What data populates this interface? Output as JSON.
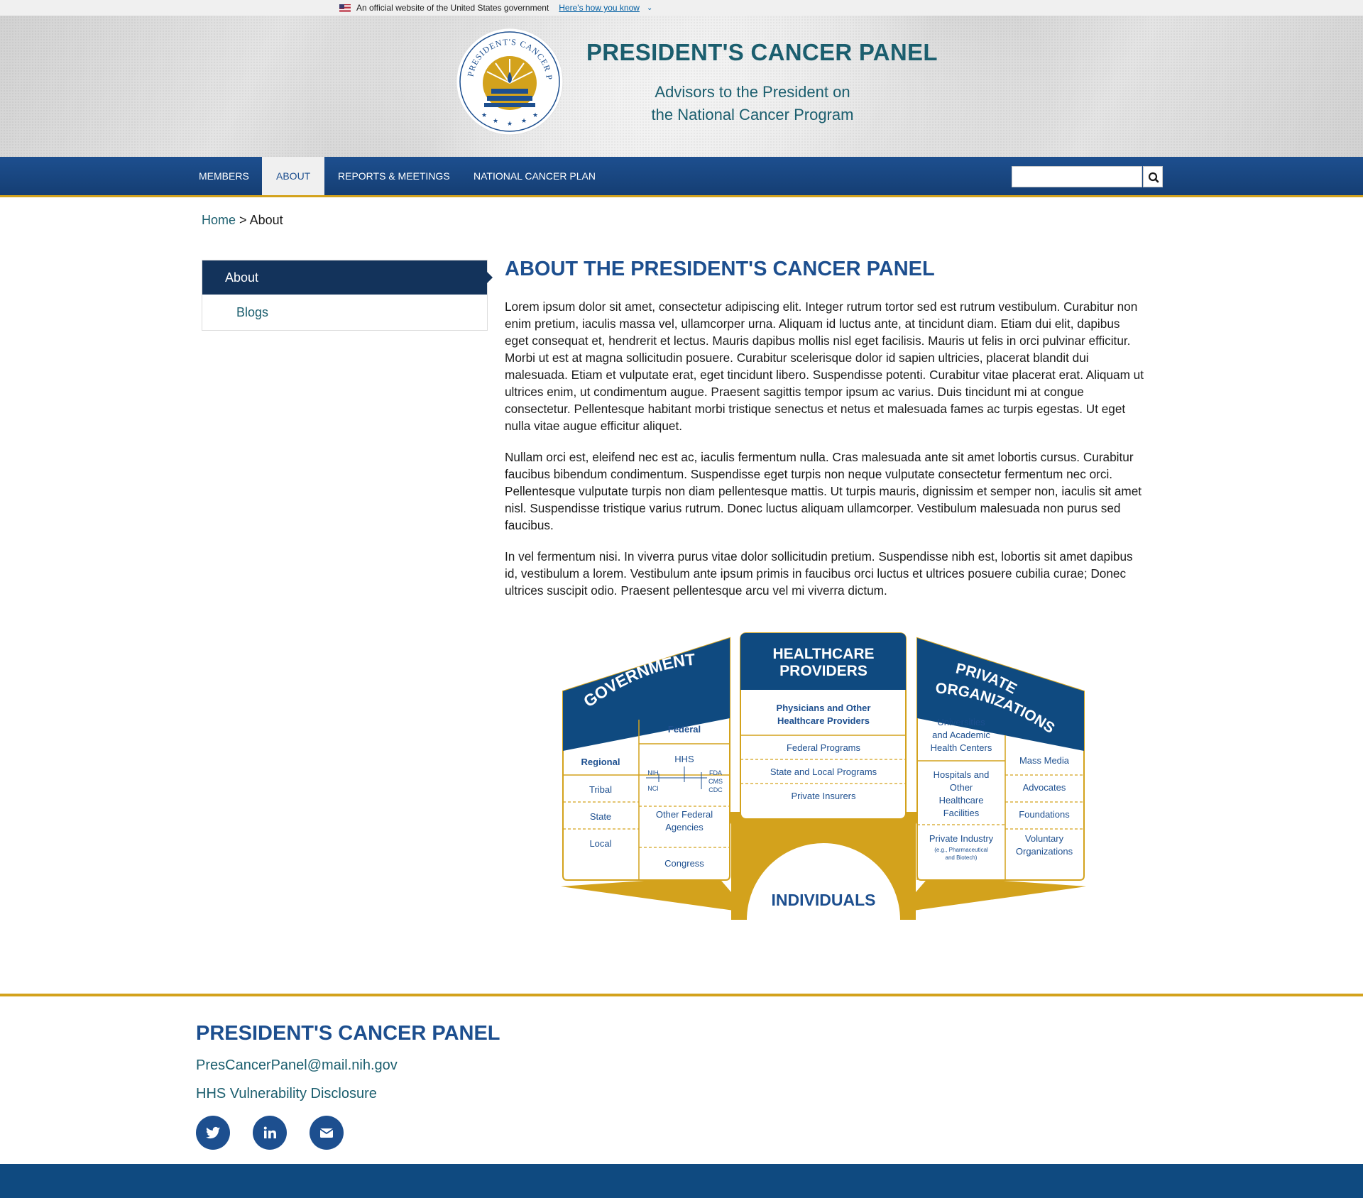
{
  "gov_banner": {
    "text": "An official website of the United States government",
    "link": "Here's how you know"
  },
  "header": {
    "title": "PRESIDENT'S CANCER PANEL",
    "subtitle_line1": "Advisors to the President on",
    "subtitle_line2": "the National Cancer Program",
    "seal_text": "PRESIDENT'S CANCER PANEL"
  },
  "nav": {
    "items": [
      {
        "label": "MEMBERS"
      },
      {
        "label": "ABOUT"
      },
      {
        "label": "REPORTS & MEETINGS"
      },
      {
        "label": "NATIONAL CANCER PLAN"
      }
    ],
    "search_placeholder": ""
  },
  "breadcrumb": {
    "home": "Home",
    "separator": ">",
    "current": "About"
  },
  "sidebar": {
    "items": [
      {
        "label": "About"
      },
      {
        "label": "Blogs"
      }
    ]
  },
  "main": {
    "heading": "ABOUT THE PRESIDENT'S CANCER PANEL",
    "paragraphs": [
      "Lorem ipsum dolor sit amet, consectetur adipiscing elit. Integer rutrum tortor sed est rutrum vestibulum. Curabitur non enim pretium, iaculis massa vel, ullamcorper urna. Aliquam id luctus ante, at tincidunt diam. Etiam dui elit, dapibus eget consequat et, hendrerit et lectus. Mauris dapibus mollis nisl eget facilisis. Mauris ut felis in orci pulvinar efficitur. Morbi ut est at magna sollicitudin posuere. Curabitur scelerisque dolor id sapien ultricies, placerat blandit dui malesuada. Etiam et vulputate erat, eget tincidunt libero. Suspendisse potenti. Curabitur vitae placerat erat. Aliquam ut ultrices enim, ut condimentum augue. Praesent sagittis tempor ipsum ac varius. Duis tincidunt mi at congue consectetur. Pellentesque habitant morbi tristique senectus et netus et malesuada fames ac turpis egestas. Ut eget nulla vitae augue efficitur aliquet.",
      "Nullam orci est, eleifend nec est ac, iaculis fermentum nulla. Cras malesuada ante sit amet lobortis cursus. Curabitur faucibus bibendum condimentum. Suspendisse eget turpis non neque vulputate consectetur fermentum nec orci. Pellentesque vulputate turpis non diam pellentesque mattis. Ut turpis mauris, dignissim et semper non, iaculis sit amet nisl. Suspendisse tristique varius rutrum. Donec luctus aliquam ullamcorper. Vestibulum malesuada non purus sed faucibus.",
      "In vel fermentum nisi. In viverra purus vitae dolor sollicitudin pretium. Suspendisse nibh est, lobortis sit amet dapibus id, vestibulum a lorem. Vestibulum ante ipsum primis in faucibus orci luctus et ultrices posuere cubilia curae; Donec ultrices suscipit odio. Praesent pellentesque arcu vel mi viverra dictum."
    ]
  },
  "diagram": {
    "government": {
      "title": "GOVERNMENT",
      "regional": {
        "header": "Regional",
        "items": [
          "Tribal",
          "State",
          "Local"
        ]
      },
      "federal": {
        "header": "Federal",
        "hhs": "HHS",
        "hhs_left": [
          "NIH",
          "NCI"
        ],
        "hhs_right": [
          "FDA",
          "CMS",
          "CDC"
        ],
        "other_line1": "Other Federal",
        "other_line2": "Agencies",
        "congress": "Congress"
      }
    },
    "healthcare": {
      "title_line1": "HEALTHCARE",
      "title_line2": "PROVIDERS",
      "header_line1": "Physicians and Other",
      "header_line2": "Healthcare Providers",
      "items": [
        "Federal Programs",
        "State and Local Programs",
        "Private Insurers"
      ]
    },
    "private": {
      "title_line1": "PRIVATE",
      "title_line2": "ORGANIZATIONS",
      "left": {
        "universities": [
          "Universities",
          "and Academic",
          "Health Centers"
        ],
        "hospitals": [
          "Hospitals and",
          "Other",
          "Healthcare",
          "Facilities"
        ],
        "industry": "Private Industry",
        "industry_note1": "(e.g., Pharmaceutical",
        "industry_note2": "and Biotech)"
      },
      "right": {
        "items": [
          "Mass Media",
          "Advocates",
          "Foundations"
        ],
        "voluntary": [
          "Voluntary",
          "Organizations"
        ]
      }
    },
    "individuals": "INDIVIDUALS"
  },
  "footer": {
    "title": "PRESIDENT'S CANCER PANEL",
    "email": "PresCancerPanel@mail.nih.gov",
    "hhs_link": "HHS Vulnerability Disclosure",
    "social": [
      "twitter-icon",
      "linkedin-icon",
      "email-icon"
    ]
  },
  "colors": {
    "navy": "#1d4f8f",
    "dark_navy": "#13335b",
    "teal_text": "#1b5e6e",
    "gold": "#d3a21c",
    "footer_bar": "#0f4a80"
  }
}
